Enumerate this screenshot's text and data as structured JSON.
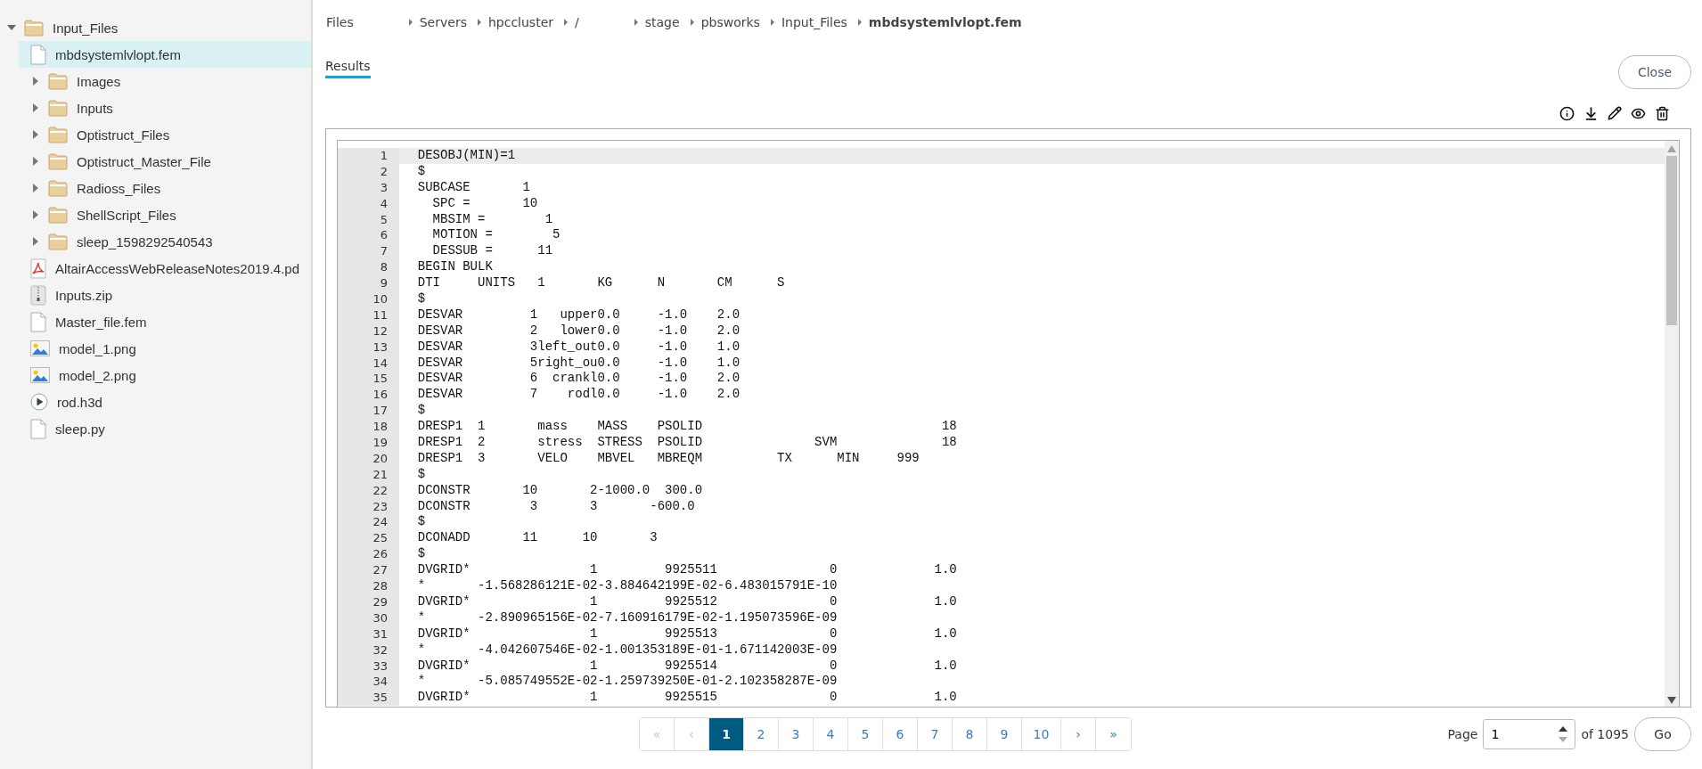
{
  "sidebar": {
    "tree": [
      {
        "kind": "folder",
        "name": "Input_Files",
        "expanded": true,
        "selected": false,
        "children": [
          {
            "kind": "file",
            "name": "mbdsystemlvlopt.fem",
            "selected": true
          },
          {
            "kind": "folder",
            "name": "Images",
            "expanded": false,
            "selected": false
          },
          {
            "kind": "folder",
            "name": "Inputs",
            "expanded": false,
            "selected": false
          },
          {
            "kind": "folder",
            "name": "Optistruct_Files",
            "expanded": false,
            "selected": false
          },
          {
            "kind": "folder",
            "name": "Optistruct_Master_File",
            "expanded": false,
            "selected": false
          },
          {
            "kind": "folder",
            "name": "Radioss_Files",
            "expanded": false,
            "selected": false
          },
          {
            "kind": "folder",
            "name": "ShellScript_Files",
            "expanded": false,
            "selected": false
          },
          {
            "kind": "folder",
            "name": "sleep_1598292540543",
            "expanded": false,
            "selected": false
          },
          {
            "kind": "pdf",
            "name": "AltairAccessWebReleaseNotes2019.4.pd",
            "selected": false
          },
          {
            "kind": "zip",
            "name": "Inputs.zip",
            "selected": false
          },
          {
            "kind": "file",
            "name": "Master_file.fem",
            "selected": false
          },
          {
            "kind": "image",
            "name": "model_1.png",
            "selected": false
          },
          {
            "kind": "image",
            "name": "model_2.png",
            "selected": false
          },
          {
            "kind": "video",
            "name": "rod.h3d",
            "selected": false
          },
          {
            "kind": "file",
            "name": "sleep.py",
            "selected": false
          }
        ]
      }
    ]
  },
  "breadcrumb": [
    "Files",
    "Servers",
    "hpccluster",
    "/",
    "stage",
    "pbsworks",
    "Input_Files",
    "mbdsystemlvlopt.fem"
  ],
  "tabs": [
    {
      "label": "Results",
      "selected": true
    }
  ],
  "close_button": "Close",
  "editor": {
    "lines": [
      {
        "number": "1",
        "text": "DESOBJ(MIN)=1",
        "active": true
      },
      {
        "number": "2",
        "text": "$",
        "active": false
      },
      {
        "number": "3",
        "text": "SUBCASE       1",
        "active": false
      },
      {
        "number": "4",
        "text": "  SPC =       10",
        "active": false
      },
      {
        "number": "5",
        "text": "  MBSIM =        1",
        "active": false
      },
      {
        "number": "6",
        "text": "  MOTION =        5",
        "active": false
      },
      {
        "number": "7",
        "text": "  DESSUB =      11",
        "active": false
      },
      {
        "number": "8",
        "text": "BEGIN BULK",
        "active": false
      },
      {
        "number": "9",
        "text": "DTI     UNITS   1       KG      N       CM      S",
        "active": false
      },
      {
        "number": "10",
        "text": "$",
        "active": false
      },
      {
        "number": "11",
        "text": "DESVAR         1   upper0.0     -1.0    2.0",
        "active": false
      },
      {
        "number": "12",
        "text": "DESVAR         2   lower0.0     -1.0    2.0",
        "active": false
      },
      {
        "number": "13",
        "text": "DESVAR         3left_out0.0     -1.0    1.0",
        "active": false
      },
      {
        "number": "14",
        "text": "DESVAR         5right_ou0.0     -1.0    1.0",
        "active": false
      },
      {
        "number": "15",
        "text": "DESVAR         6  crankl0.0     -1.0    2.0",
        "active": false
      },
      {
        "number": "16",
        "text": "DESVAR         7    rodl0.0     -1.0    2.0",
        "active": false
      },
      {
        "number": "17",
        "text": "$",
        "active": false
      },
      {
        "number": "18",
        "text": "DRESP1  1       mass    MASS    PSOLID                                18",
        "active": false
      },
      {
        "number": "19",
        "text": "DRESP1  2       stress  STRESS  PSOLID               SVM              18",
        "active": false
      },
      {
        "number": "20",
        "text": "DRESP1  3       VELO    MBVEL   MBREQM          TX      MIN     999",
        "active": false
      },
      {
        "number": "21",
        "text": "$",
        "active": false
      },
      {
        "number": "22",
        "text": "DCONSTR       10       2-1000.0  300.0",
        "active": false
      },
      {
        "number": "23",
        "text": "DCONSTR        3       3       -600.0",
        "active": false
      },
      {
        "number": "24",
        "text": "$",
        "active": false
      },
      {
        "number": "25",
        "text": "DCONADD       11      10       3",
        "active": false
      },
      {
        "number": "26",
        "text": "$",
        "active": false
      },
      {
        "number": "27",
        "text": "DVGRID*                1         9925511               0             1.0",
        "active": false
      },
      {
        "number": "28",
        "text": "*       -1.568286121E-02-3.884642199E-02-6.483015791E-10",
        "active": false
      },
      {
        "number": "29",
        "text": "DVGRID*                1         9925512               0             1.0",
        "active": false
      },
      {
        "number": "30",
        "text": "*       -2.890965156E-02-7.160916179E-02-1.195073596E-09",
        "active": false
      },
      {
        "number": "31",
        "text": "DVGRID*                1         9925513               0             1.0",
        "active": false
      },
      {
        "number": "32",
        "text": "*       -4.042607546E-02-1.001353189E-01-1.671142003E-09",
        "active": false
      },
      {
        "number": "33",
        "text": "DVGRID*                1         9925514               0             1.0",
        "active": false
      },
      {
        "number": "34",
        "text": "*       -5.085749552E-02-1.259739250E-01-2.102358287E-09",
        "active": false
      },
      {
        "number": "35",
        "text": "DVGRID*                1         9925515               0             1.0",
        "active": false
      }
    ]
  },
  "pagination": {
    "pages": [
      {
        "label": "«",
        "selected": false,
        "disabled": true
      },
      {
        "label": "‹",
        "selected": false,
        "disabled": true
      },
      {
        "label": "1",
        "selected": true,
        "disabled": false
      },
      {
        "label": "2",
        "selected": false,
        "disabled": false
      },
      {
        "label": "3",
        "selected": false,
        "disabled": false
      },
      {
        "label": "4",
        "selected": false,
        "disabled": false
      },
      {
        "label": "5",
        "selected": false,
        "disabled": false
      },
      {
        "label": "6",
        "selected": false,
        "disabled": false
      },
      {
        "label": "7",
        "selected": false,
        "disabled": false
      },
      {
        "label": "8",
        "selected": false,
        "disabled": false
      },
      {
        "label": "9",
        "selected": false,
        "disabled": false
      },
      {
        "label": "10",
        "selected": false,
        "disabled": false
      },
      {
        "label": "›",
        "selected": false,
        "disabled": false
      },
      {
        "label": "»",
        "selected": false,
        "disabled": false
      }
    ],
    "page_label": "Page",
    "page_value": "1",
    "of_label": "of 1095",
    "go_button": "Go"
  }
}
